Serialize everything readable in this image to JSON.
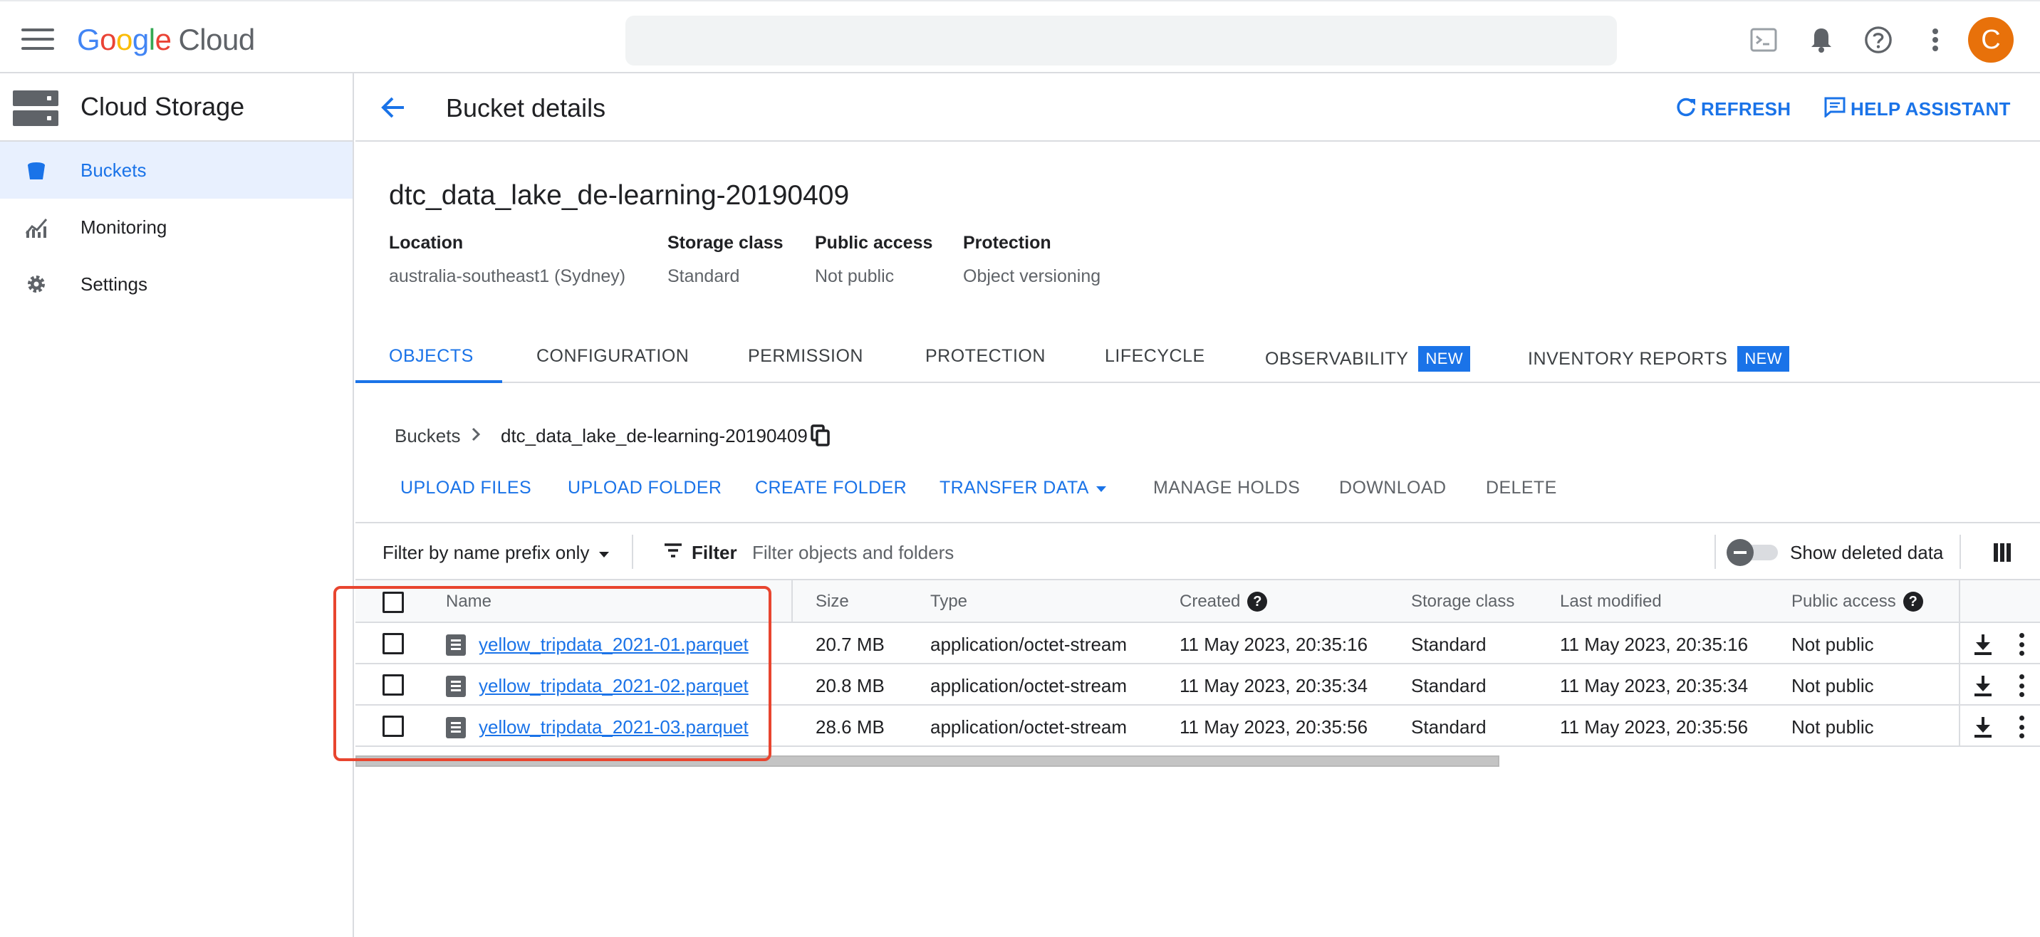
{
  "app": {
    "logo_letters": [
      "G",
      "o",
      "o",
      "g",
      "l",
      "e"
    ],
    "logo_suffix": "Cloud",
    "avatar_letter": "C"
  },
  "sidebar": {
    "title": "Cloud Storage",
    "items": [
      {
        "label": "Buckets",
        "icon": "bucket-icon",
        "active": true
      },
      {
        "label": "Monitoring",
        "icon": "monitoring-icon",
        "active": false
      },
      {
        "label": "Settings",
        "icon": "gear-icon",
        "active": false
      }
    ]
  },
  "header": {
    "title": "Bucket details",
    "refresh_label": "REFRESH",
    "help_label": "HELP ASSISTANT"
  },
  "bucket": {
    "name": "dtc_data_lake_de-learning-20190409",
    "meta": [
      {
        "label": "Location",
        "value": "australia-southeast1 (Sydney)"
      },
      {
        "label": "Storage class",
        "value": "Standard"
      },
      {
        "label": "Public access",
        "value": "Not public"
      },
      {
        "label": "Protection",
        "value": "Object versioning"
      }
    ]
  },
  "tabs": [
    {
      "label": "OBJECTS",
      "active": true,
      "badge": ""
    },
    {
      "label": "CONFIGURATION",
      "active": false,
      "badge": ""
    },
    {
      "label": "PERMISSION",
      "active": false,
      "badge": ""
    },
    {
      "label": "PROTECTION",
      "active": false,
      "badge": ""
    },
    {
      "label": "LIFECYCLE",
      "active": false,
      "badge": ""
    },
    {
      "label": "OBSERVABILITY",
      "active": false,
      "badge": "NEW"
    },
    {
      "label": "INVENTORY REPORTS",
      "active": false,
      "badge": "NEW"
    }
  ],
  "breadcrumb": {
    "root": "Buckets",
    "current": "dtc_data_lake_de-learning-20190409"
  },
  "actions": [
    {
      "label": "UPLOAD FILES",
      "enabled": true
    },
    {
      "label": "UPLOAD FOLDER",
      "enabled": true
    },
    {
      "label": "CREATE FOLDER",
      "enabled": true
    },
    {
      "label": "TRANSFER DATA",
      "enabled": true
    },
    {
      "label": "MANAGE HOLDS",
      "enabled": false
    },
    {
      "label": "DOWNLOAD",
      "enabled": false
    },
    {
      "label": "DELETE",
      "enabled": false
    }
  ],
  "filter": {
    "mode_label": "Filter by name prefix only",
    "filter_label": "Filter",
    "placeholder": "Filter objects and folders",
    "show_deleted_label": "Show deleted data"
  },
  "table": {
    "columns": [
      "Name",
      "Size",
      "Type",
      "Created",
      "Storage class",
      "Last modified",
      "Public access"
    ],
    "rows": [
      {
        "name": "yellow_tripdata_2021-01.parquet",
        "size": "20.7 MB",
        "type": "application/octet-stream",
        "created": "11 May 2023, 20:35:16",
        "storage_class": "Standard",
        "last_modified": "11 May 2023, 20:35:16",
        "public_access": "Not public"
      },
      {
        "name": "yellow_tripdata_2021-02.parquet",
        "size": "20.8 MB",
        "type": "application/octet-stream",
        "created": "11 May 2023, 20:35:34",
        "storage_class": "Standard",
        "last_modified": "11 May 2023, 20:35:34",
        "public_access": "Not public"
      },
      {
        "name": "yellow_tripdata_2021-03.parquet",
        "size": "28.6 MB",
        "type": "application/octet-stream",
        "created": "11 May 2023, 20:35:56",
        "storage_class": "Standard",
        "last_modified": "11 May 2023, 20:35:56",
        "public_access": "Not public"
      }
    ]
  },
  "colors": {
    "accent": "#1a73e8",
    "highlight": "#e8452f",
    "avatar": "#e8710a"
  }
}
